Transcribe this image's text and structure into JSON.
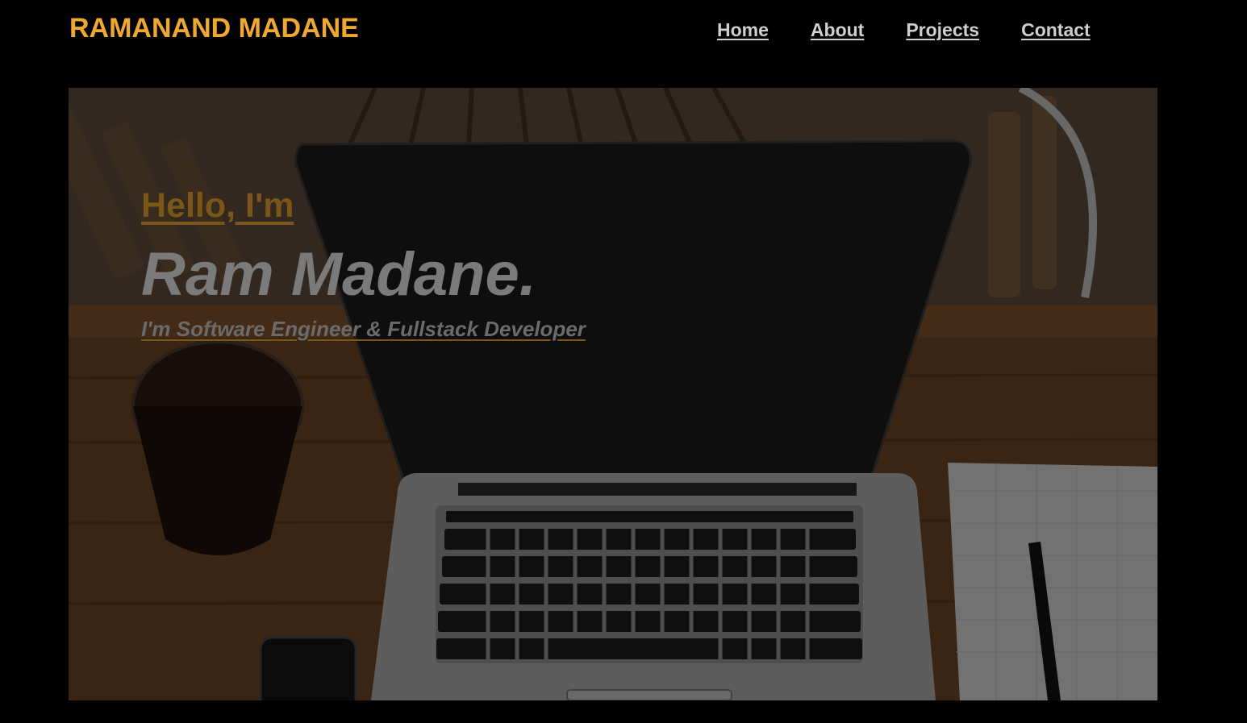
{
  "header": {
    "brand": "RAMANAND MADANE",
    "nav": [
      {
        "label": "Home"
      },
      {
        "label": "About"
      },
      {
        "label": "Projects"
      },
      {
        "label": "Contact"
      }
    ]
  },
  "hero": {
    "greeting": "Hello, I'm",
    "name": "Ram Madane.",
    "tagline": "I'm Software Engineer & Fullstack Developer",
    "background_image": "laptop-on-wooden-cafe-table"
  },
  "colors": {
    "background": "#000000",
    "brand": "#f0a830",
    "nav_text": "#cfcfcf",
    "greeting": "#7a5718",
    "name": "#7a7a7a"
  }
}
